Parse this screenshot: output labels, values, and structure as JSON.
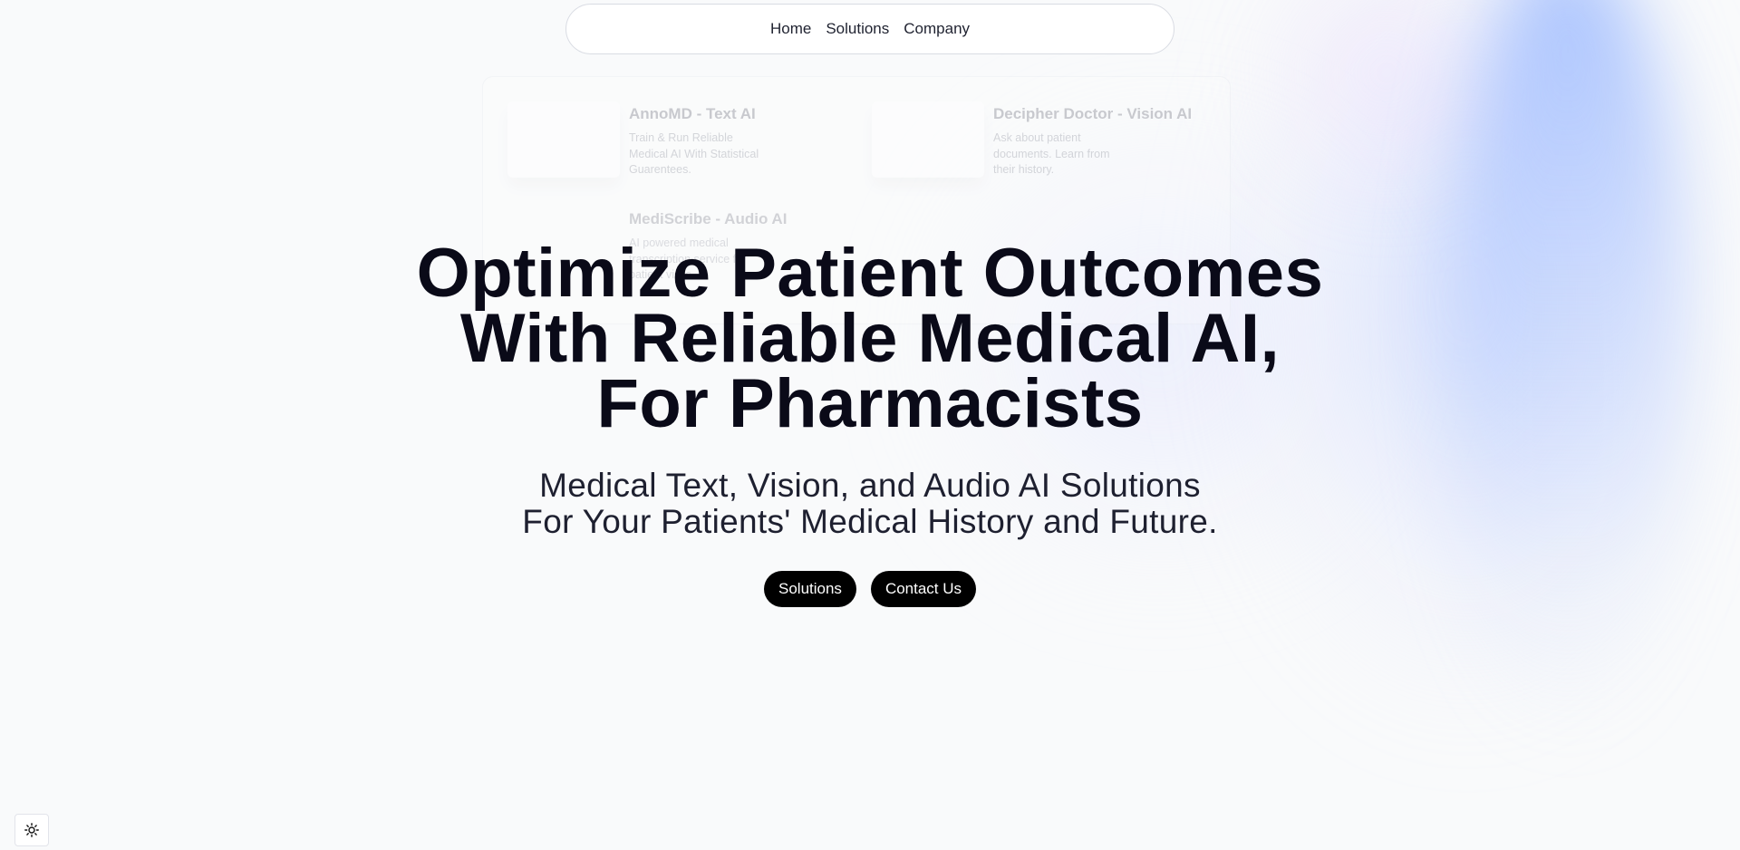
{
  "nav": {
    "items": [
      {
        "label": "Home"
      },
      {
        "label": "Solutions"
      },
      {
        "label": "Company"
      }
    ]
  },
  "menu": {
    "items": [
      {
        "title": "AnnoMD - Text AI",
        "description": "Train & Run Reliable Medical AI With Statistical Guarentees."
      },
      {
        "title": "Decipher Doctor - Vision AI",
        "description": "Ask about patient documents. Learn from their history."
      },
      {
        "title": "MediScribe - Audio AI",
        "description": "AI powered medical transcription service for patient visits."
      }
    ]
  },
  "hero": {
    "title_lines": [
      "Optimize Patient Outcomes",
      "With Reliable Medical AI,",
      "For Pharmacists"
    ],
    "subtitle_lines": [
      "Medical Text, Vision, and Audio AI Solutions",
      "For Your Patients' Medical History and Future."
    ]
  },
  "cta": {
    "solutions_label": "Solutions",
    "contact_label": "Contact Us"
  },
  "theme_toggle": {
    "icon": "sun-icon"
  },
  "colors": {
    "background": "#f9fafb",
    "button": "#000000",
    "button_text": "#ffffff",
    "heading": "#0a0a18",
    "accent_gradient": "#8cafff"
  }
}
